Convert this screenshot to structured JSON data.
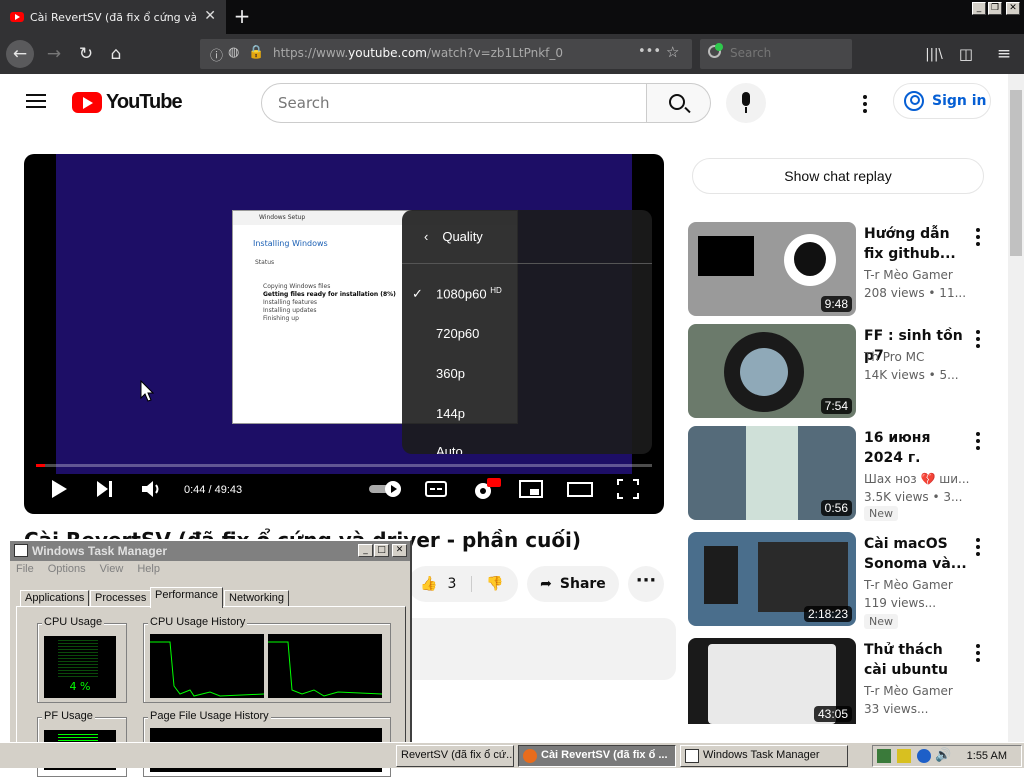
{
  "browser": {
    "tab_title": "Cài RevertSV (đã fix ổ cứng và dr",
    "url_prefix": "https://www.",
    "url_domain": "youtube.com",
    "url_rest": "/watch?v=zb1LtPnkf_0",
    "search_placeholder": "Search",
    "new_tab": "+",
    "close_tab": "✕"
  },
  "youtube": {
    "logo_text": "YouTube",
    "search_placeholder": "Search",
    "sign_in": "Sign in",
    "show_chat_replay": "Show chat replay"
  },
  "player": {
    "time": "0:44 / 49:43",
    "progress_fraction": 0.015,
    "quality_menu": {
      "title": "Quality",
      "items": [
        "1080p60",
        "720p60",
        "360p",
        "144p",
        "Auto"
      ],
      "selected": "1080p60",
      "hd_badge": "HD"
    },
    "setup_window": {
      "title": "Windows Setup",
      "heading": "Installing Windows",
      "status": "Status",
      "steps": [
        "Copying Windows files",
        "Getting files ready for installation (8%)",
        "Installing features",
        "Installing updates",
        "Finishing up"
      ]
    }
  },
  "video": {
    "title": "Cài RevertSV (đã fix ổ cứng và driver - phần cuối)",
    "likes": "3",
    "share": "Share"
  },
  "recommendations": [
    {
      "title": "Hướng dẫn fix github...",
      "channel": "T-r Mèo Gamer",
      "meta": "208 views • 11...",
      "duration": "9:48",
      "badge": ""
    },
    {
      "title": "FF : sinh tồn p7",
      "channel": "Th Pro MC",
      "meta": "14K views • 5...",
      "duration": "7:54",
      "badge": ""
    },
    {
      "title": "16 июня 2024 г.",
      "channel": "Шах ноз 💔 ши...",
      "meta": "3.5K views • 3...",
      "duration": "0:56",
      "badge": "New"
    },
    {
      "title": "Cài macOS Sonoma và...",
      "channel": "T-r Mèo Gamer",
      "meta": "119 views...",
      "duration": "2:18:23",
      "badge": "New"
    },
    {
      "title": "Thử thách cài ubuntu với bà...",
      "channel": "T-r Mèo Gamer",
      "meta": "33 views...",
      "duration": "43:05",
      "badge": ""
    }
  ],
  "task_manager": {
    "title": "Windows Task Manager",
    "menu": [
      "File",
      "Options",
      "View",
      "Help"
    ],
    "tabs": [
      "Applications",
      "Processes",
      "Performance",
      "Networking"
    ],
    "active_tab": "Performance",
    "cpu_usage_label": "CPU Usage",
    "cpu_usage_value": "4 %",
    "cpu_history_label": "CPU Usage History",
    "pf_usage_label": "PF Usage",
    "pf_history_label": "Page File Usage History"
  },
  "taskbar": {
    "items": [
      "RevertSV (đã fix ổ cứ...",
      "Cài RevertSV (đã fix ổ ...",
      "Windows Task Manager"
    ],
    "active_item": "Cài RevertSV (đã fix ổ ...",
    "clock": "1:55 AM"
  },
  "colors": {
    "youtube_red": "#ff0000",
    "link_blue": "#065fd4",
    "graph_green": "#00ff00",
    "firefox_chrome": "#323234"
  }
}
